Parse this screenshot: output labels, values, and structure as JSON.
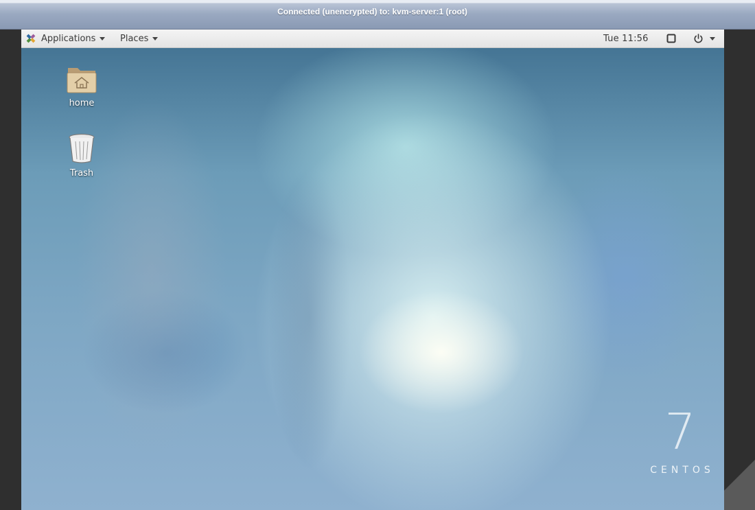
{
  "vnc": {
    "title": "Connected (unencrypted) to: kvm-server:1 (root)"
  },
  "panel": {
    "applications_label": "Applications",
    "places_label": "Places",
    "clock": "Tue 11:56"
  },
  "desktop": {
    "icons": [
      {
        "label": "home",
        "icon": "home-folder-icon"
      },
      {
        "label": "Trash",
        "icon": "trash-icon"
      }
    ],
    "logo": {
      "number": "7",
      "word": "CENTOS"
    }
  },
  "colors": {
    "panel_bg": "#e8e8e8",
    "titlebar": "#9aa9c1",
    "desktop_base": "#6c9cb8"
  }
}
